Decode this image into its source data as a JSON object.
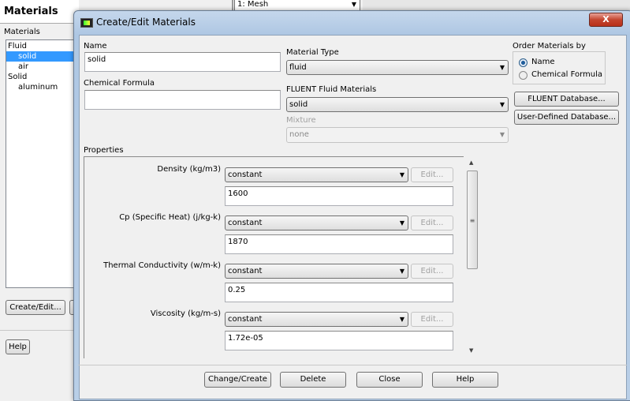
{
  "background": {
    "panel_title": "Materials",
    "list_label": "Materials",
    "tree": [
      {
        "label": "Fluid",
        "level": 0
      },
      {
        "label": "solid",
        "level": 1,
        "selected": true
      },
      {
        "label": "air",
        "level": 1
      },
      {
        "label": "Solid",
        "level": 0
      },
      {
        "label": "aluminum",
        "level": 1
      }
    ],
    "create_edit": "Create/Edit...",
    "help": "Help",
    "view_select": "1: Mesh"
  },
  "dialog": {
    "title": "Create/Edit Materials",
    "name_label": "Name",
    "name_value": "solid",
    "formula_label": "Chemical Formula",
    "formula_value": "",
    "material_type_label": "Material Type",
    "material_type": "fluid",
    "fluent_materials_label": "FLUENT Fluid Materials",
    "fluent_material": "solid",
    "mixture_label": "Mixture",
    "mixture": "none",
    "order_label": "Order Materials by",
    "order_options": [
      "Name",
      "Chemical Formula"
    ],
    "order_selected": "Name",
    "fluent_db": "FLUENT Database...",
    "user_db": "User-Defined Database...",
    "properties_label": "Properties",
    "properties": [
      {
        "label": "Density (kg/m3)",
        "method": "constant",
        "value": "1600",
        "edit": "Edit..."
      },
      {
        "label": "Cp (Specific Heat) (j/kg-k)",
        "method": "constant",
        "value": "1870",
        "edit": "Edit..."
      },
      {
        "label": "Thermal Conductivity (w/m-k)",
        "method": "constant",
        "value": "0.25",
        "edit": "Edit..."
      },
      {
        "label": "Viscosity (kg/m-s)",
        "method": "constant",
        "value": "1.72e-05",
        "edit": "Edit..."
      }
    ],
    "buttons": {
      "change": "Change/Create",
      "delete": "Delete",
      "close": "Close",
      "help": "Help"
    }
  }
}
